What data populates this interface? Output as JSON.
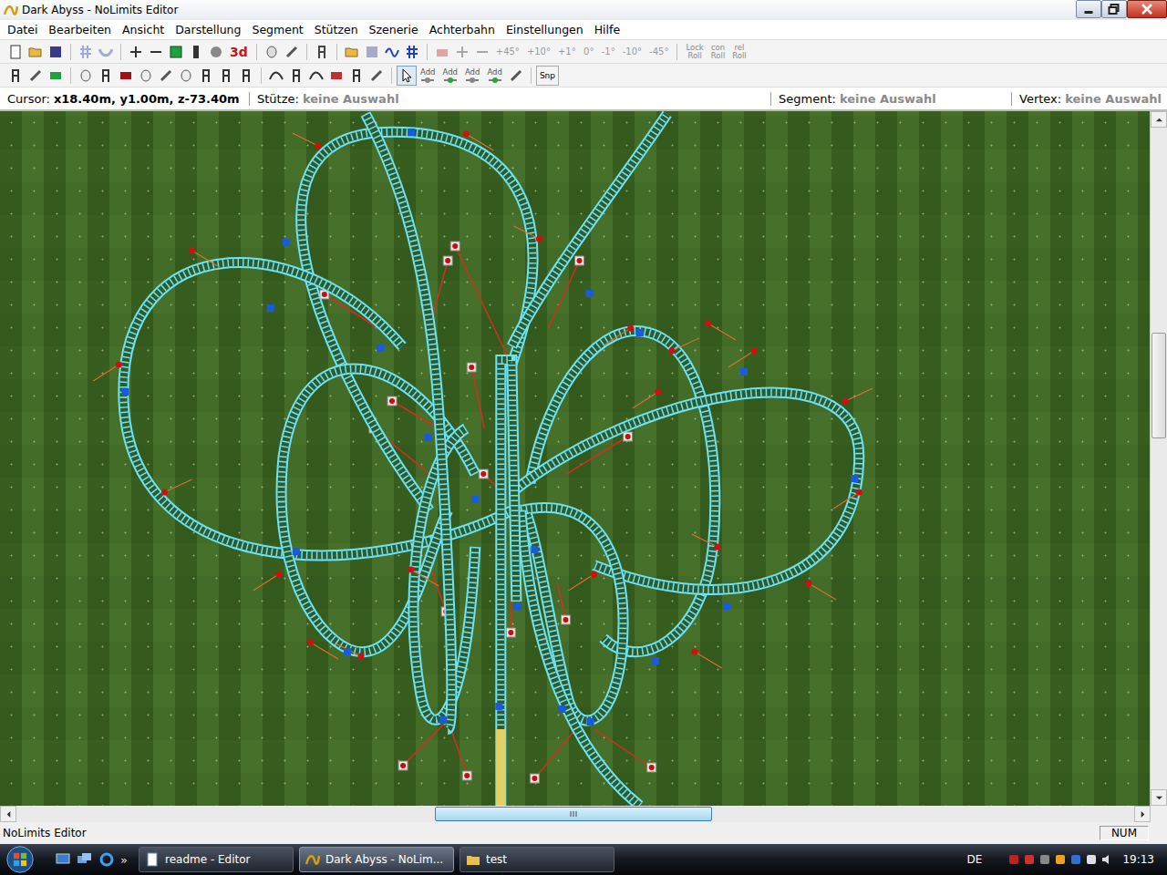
{
  "window": {
    "title": "Dark Abyss - NoLimits Editor"
  },
  "menu": [
    "Datei",
    "Bearbeiten",
    "Ansicht",
    "Darstellung",
    "Segment",
    "Stützen",
    "Szenerie",
    "Achterbahn",
    "Einstellungen",
    "Hilfe"
  ],
  "toolbar1": [
    {
      "kind": "icon",
      "disabled": false
    },
    {
      "kind": "icon",
      "disabled": false
    },
    {
      "kind": "icon",
      "disabled": false
    },
    {
      "kind": "sep"
    },
    {
      "kind": "icon",
      "disabled": true
    },
    {
      "kind": "icon",
      "disabled": true
    },
    {
      "kind": "sep"
    },
    {
      "kind": "icon",
      "disabled": false
    },
    {
      "kind": "icon",
      "disabled": false
    },
    {
      "kind": "icon",
      "disabled": false
    },
    {
      "kind": "icon",
      "disabled": false
    },
    {
      "kind": "icon",
      "disabled": false
    },
    {
      "kind": "text",
      "label": "3d",
      "disabled": false,
      "color": "#d01010"
    },
    {
      "kind": "sep"
    },
    {
      "kind": "icon",
      "disabled": false
    },
    {
      "kind": "icon",
      "disabled": false
    },
    {
      "kind": "sep"
    },
    {
      "kind": "icon",
      "disabled": false
    },
    {
      "kind": "sep"
    },
    {
      "kind": "icon",
      "disabled": false
    },
    {
      "kind": "icon",
      "disabled": true
    },
    {
      "kind": "icon",
      "disabled": false
    },
    {
      "kind": "icon",
      "disabled": false
    },
    {
      "kind": "sep"
    },
    {
      "kind": "icon",
      "disabled": true
    },
    {
      "kind": "icon",
      "disabled": true
    },
    {
      "kind": "icon",
      "disabled": true
    },
    {
      "kind": "text",
      "label": "+45°",
      "disabled": true,
      "color": "#9a9a9a"
    },
    {
      "kind": "text",
      "label": "+10°",
      "disabled": true,
      "color": "#9a9a9a"
    },
    {
      "kind": "text",
      "label": "+1°",
      "disabled": true,
      "color": "#9a9a9a"
    },
    {
      "kind": "text",
      "label": "0°",
      "disabled": true,
      "color": "#9a9a9a"
    },
    {
      "kind": "text",
      "label": "-1°",
      "disabled": true,
      "color": "#9a9a9a"
    },
    {
      "kind": "text",
      "label": "-10°",
      "disabled": true,
      "color": "#9a9a9a"
    },
    {
      "kind": "text",
      "label": "-45°",
      "disabled": true,
      "color": "#9a9a9a"
    },
    {
      "kind": "sep"
    },
    {
      "kind": "roll",
      "lines": [
        "Lock",
        "Roll"
      ],
      "disabled": true
    },
    {
      "kind": "roll",
      "lines": [
        "con",
        "Roll"
      ],
      "disabled": true
    },
    {
      "kind": "roll",
      "lines": [
        "rel",
        "Roll"
      ],
      "disabled": true
    }
  ],
  "toolbar2": [
    {
      "kind": "icon",
      "selected": false
    },
    {
      "kind": "icon",
      "selected": false
    },
    {
      "kind": "icon",
      "selected": false
    },
    {
      "kind": "sep"
    },
    {
      "kind": "icon",
      "selected": false
    },
    {
      "kind": "icon",
      "selected": false
    },
    {
      "kind": "icon",
      "selected": false
    },
    {
      "kind": "icon",
      "selected": false
    },
    {
      "kind": "icon",
      "selected": false
    },
    {
      "kind": "icon",
      "selected": false
    },
    {
      "kind": "icon",
      "selected": false
    },
    {
      "kind": "icon",
      "selected": false
    },
    {
      "kind": "icon",
      "selected": false
    },
    {
      "kind": "sep"
    },
    {
      "kind": "icon",
      "selected": false
    },
    {
      "kind": "icon",
      "selected": false
    },
    {
      "kind": "icon",
      "selected": false
    },
    {
      "kind": "icon",
      "selected": false
    },
    {
      "kind": "icon",
      "selected": false
    },
    {
      "kind": "icon",
      "selected": false
    },
    {
      "kind": "sep"
    },
    {
      "kind": "icon",
      "selected": true
    },
    {
      "kind": "add",
      "label": "Add",
      "selected": false
    },
    {
      "kind": "add",
      "label": "Add",
      "selected": false
    },
    {
      "kind": "add",
      "label": "Add",
      "selected": false
    },
    {
      "kind": "add",
      "label": "Add",
      "selected": false
    },
    {
      "kind": "icon",
      "selected": false
    },
    {
      "kind": "sep"
    },
    {
      "kind": "text",
      "label": "Snp",
      "selected": false
    }
  ],
  "info_bar": [
    {
      "label": "Cursor:",
      "value": "x18.40m, y1.00m, z-73.40m",
      "active": true
    },
    {
      "label": "Stütze:",
      "value": "keine Auswahl",
      "active": false
    },
    {
      "label": "Segment:",
      "value": "keine Auswahl",
      "active": false
    },
    {
      "label": "Vertex:",
      "value": "keine Auswahl",
      "active": false
    }
  ],
  "scrollbars": {
    "vertical": {
      "start": 0.31,
      "size": 0.16
    },
    "horizontal": {
      "start": 0.374,
      "size": 0.248
    }
  },
  "status_bar": {
    "text": "NoLimits Editor",
    "indicator": "NUM"
  },
  "taskbar": {
    "tasks": [
      {
        "label": "readme - Editor",
        "selected": false
      },
      {
        "label": "Dark Abyss - NoLim...",
        "selected": true
      },
      {
        "label": "test",
        "selected": false
      }
    ],
    "chevron": "»",
    "language": "DE",
    "clock": "19:13"
  }
}
